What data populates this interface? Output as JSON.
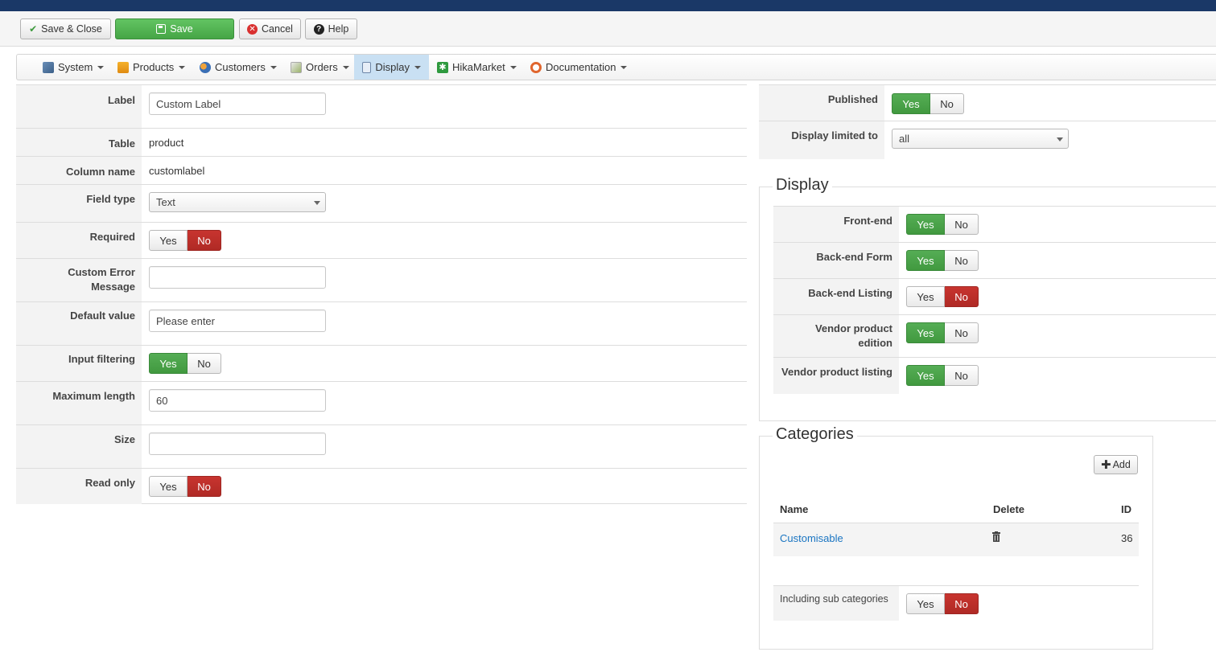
{
  "toolbar": {
    "save_close": "Save & Close",
    "save": "Save",
    "cancel": "Cancel",
    "help": "Help"
  },
  "nav": [
    {
      "label": "System",
      "icon": "wrench-icon"
    },
    {
      "label": "Products",
      "icon": "box-icon"
    },
    {
      "label": "Customers",
      "icon": "users-icon"
    },
    {
      "label": "Orders",
      "icon": "orders-icon"
    },
    {
      "label": "Display",
      "icon": "display-icon",
      "active": true
    },
    {
      "label": "HikaMarket",
      "icon": "hikamarket-icon"
    },
    {
      "label": "Documentation",
      "icon": "lifebuoy-icon"
    }
  ],
  "toggle": {
    "yes": "Yes",
    "no": "No"
  },
  "form": {
    "label": {
      "label": "Label",
      "value": "Custom Label"
    },
    "table": {
      "label": "Table",
      "value": "product"
    },
    "column": {
      "label": "Column name",
      "value": "customlabel"
    },
    "field_type": {
      "label": "Field type",
      "value": "Text"
    },
    "required": {
      "label": "Required",
      "value": "No"
    },
    "error_msg": {
      "label_line1": "Custom Error",
      "label_line2": "Message",
      "value": ""
    },
    "default": {
      "label": "Default value",
      "value": "Please enter"
    },
    "filtering": {
      "label": "Input filtering",
      "value": "Yes"
    },
    "max_length": {
      "label": "Maximum length",
      "value": "60"
    },
    "size": {
      "label": "Size",
      "value": ""
    },
    "read_only": {
      "label": "Read only",
      "value": "No"
    }
  },
  "right": {
    "published": {
      "label": "Published",
      "value": "Yes"
    },
    "limited": {
      "label": "Display limited to",
      "value": "all"
    }
  },
  "display": {
    "legend": "Display",
    "frontend": {
      "label": "Front-end",
      "value": "Yes"
    },
    "backend_form": {
      "label": "Back-end Form",
      "value": "Yes"
    },
    "backend_listing": {
      "label": "Back-end Listing",
      "value": "No"
    },
    "vendor_edition": {
      "label_line1": "Vendor product",
      "label_line2": "edition",
      "value": "Yes"
    },
    "vendor_listing": {
      "label": "Vendor product listing",
      "value": "Yes"
    }
  },
  "categories": {
    "legend": "Categories",
    "add": "Add",
    "columns": {
      "name": "Name",
      "delete": "Delete",
      "id": "ID"
    },
    "rows": [
      {
        "name": "Customisable",
        "id": "36"
      }
    ],
    "sub": {
      "label": "Including sub categories",
      "value": "No"
    }
  },
  "colors": {
    "yes_on": "#46a546",
    "no_on": "#bd2c27",
    "link": "#1a75c2",
    "topbar": "#1a3867"
  }
}
